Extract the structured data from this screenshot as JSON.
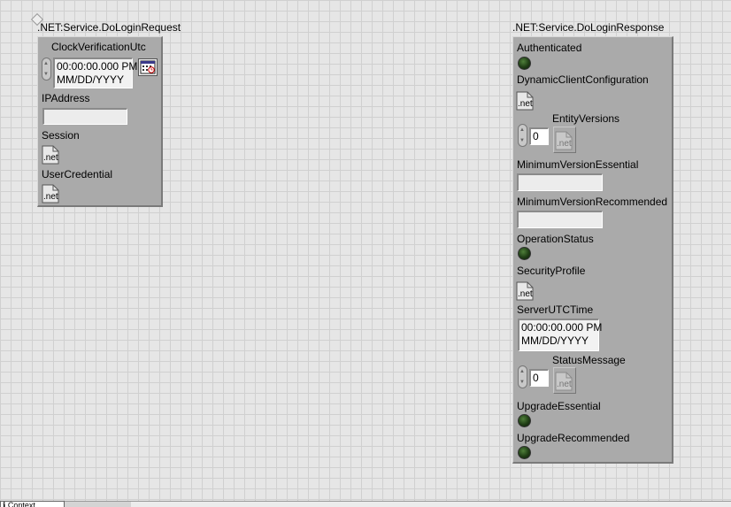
{
  "request": {
    "title": ".NET:Service.DoLoginRequest",
    "clock_label": "ClockVerificationUtc",
    "clock_time": "00:00:00.000 PM",
    "clock_date": "MM/DD/YYYY",
    "ip_label": "IPAddress",
    "ip_value": "",
    "session_label": "Session",
    "usercred_label": "UserCredential",
    "net_text": ".net"
  },
  "response": {
    "title": ".NET:Service.DoLoginResponse",
    "authenticated_label": "Authenticated",
    "dyncfg_label": "DynamicClientConfiguration",
    "entity_label": "EntityVersions",
    "entity_index": "0",
    "miness_label": "MinimumVersionEssential",
    "minrec_label": "MinimumVersionRecommended",
    "opstatus_label": "OperationStatus",
    "secprofile_label": "SecurityProfile",
    "servertime_label": "ServerUTCTime",
    "server_time": "00:00:00.000 PM",
    "server_date": "MM/DD/YYYY",
    "statusmsg_label": "StatusMessage",
    "statusmsg_index": "0",
    "upgess_label": "UpgradeEssential",
    "upgrec_label": "UpgradeRecommended",
    "net_text": ".net"
  },
  "colors": {
    "cluster_bg": "#aaaaaa",
    "grid_bg": "#e6e6e6",
    "led_off": "#1f3d15"
  },
  "statusbar": {
    "tab_label": "ℹ Context"
  }
}
